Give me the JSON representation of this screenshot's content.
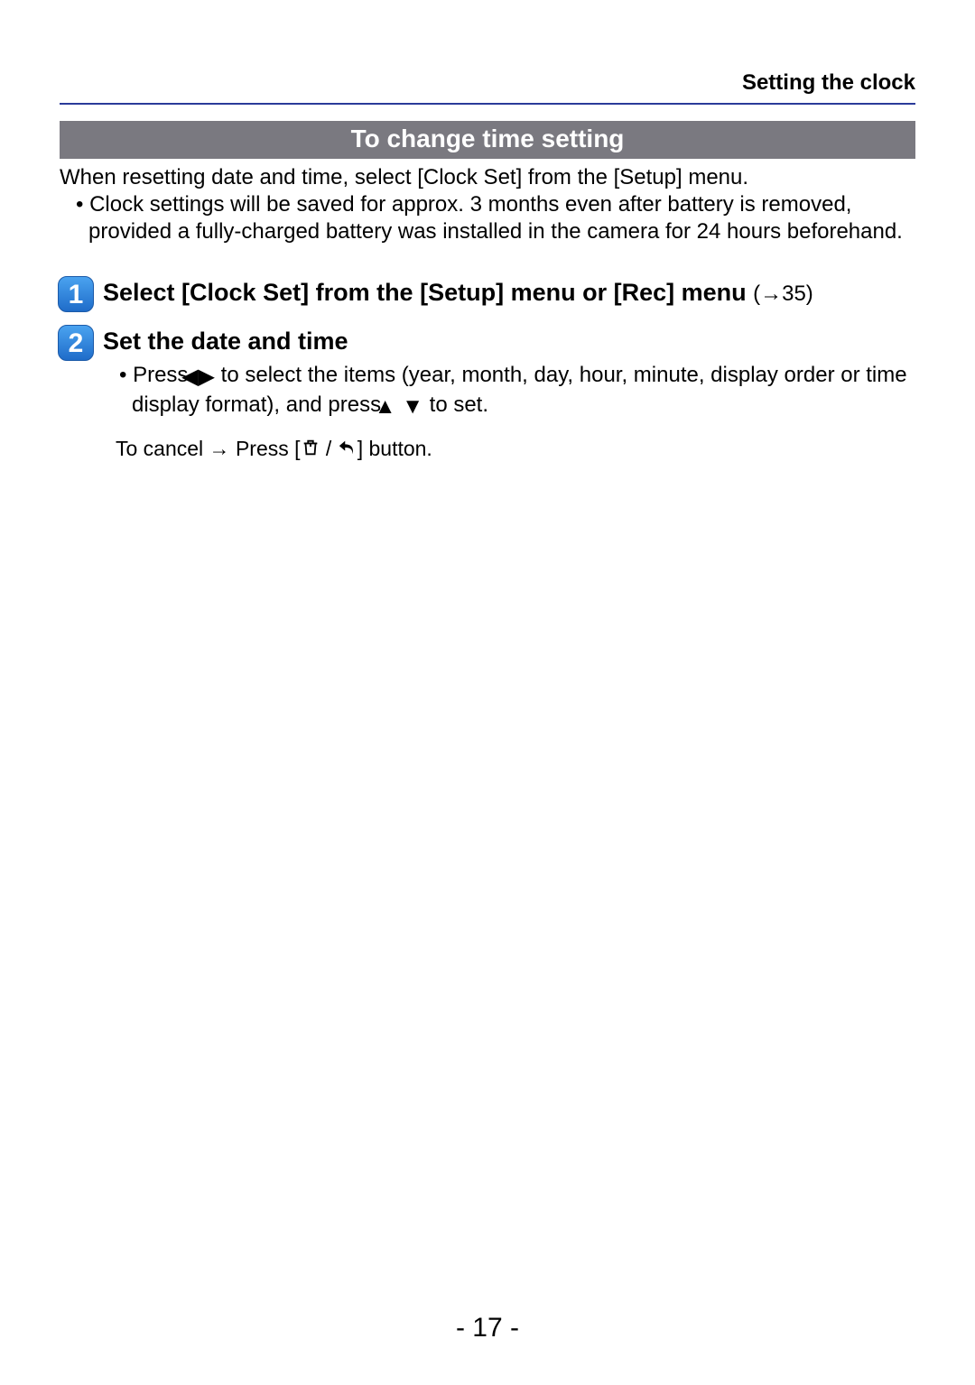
{
  "header": {
    "section_title": "Setting the clock"
  },
  "section_bar": "To change time setting",
  "intro": {
    "line": "When resetting date and time, select [Clock Set] from the [Setup] menu.",
    "bullet": "Clock settings will be saved for approx. 3 months even after battery is removed, provided a fully-charged battery was installed in the camera for 24 hours beforehand."
  },
  "steps": {
    "one": {
      "num": "1",
      "title": "Select [Clock Set] from the [Setup] menu or [Rec] menu ",
      "ref": "(→35)"
    },
    "two": {
      "num": "2",
      "title": "Set the date and time",
      "bullet_pre": "Press ",
      "bullet_mid1": " to select the items (year, month, day, hour, minute, display order or time display format), and press ",
      "bullet_post": " to set.",
      "cancel_pre": "To cancel → Press [",
      "cancel_sep": " / ",
      "cancel_post": "] button."
    }
  },
  "icons": {
    "left_right": "◀▶",
    "up_down": "▲ ▼"
  },
  "page_number": "- 17 -"
}
